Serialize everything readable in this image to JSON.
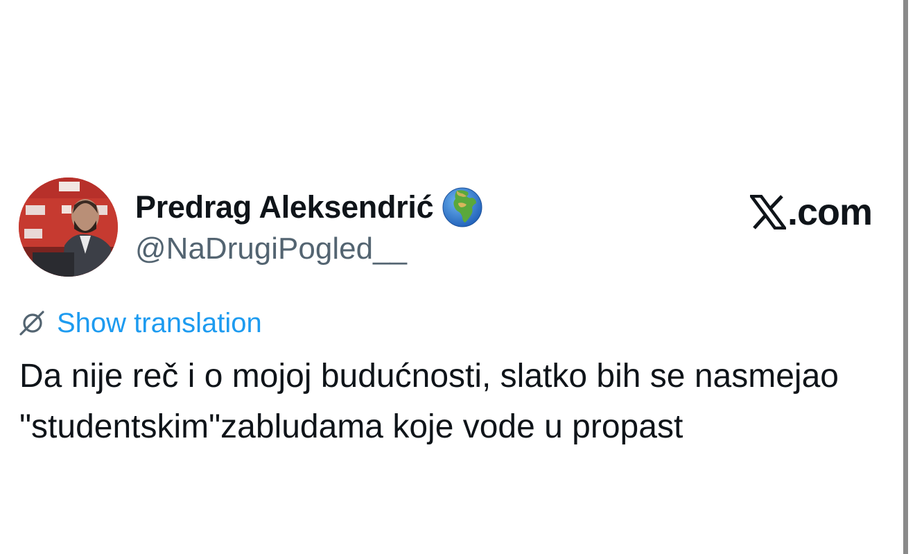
{
  "tweet": {
    "author": {
      "display_name": "Predrag Aleksendrić",
      "handle": "@NaDrugiPogled__",
      "badge_icon": "globe-africa-europe-icon",
      "avatar": "avatar-photo"
    },
    "brand": {
      "icon": "x-logo-icon",
      "text": ".com"
    },
    "translation": {
      "icon": "translate-icon",
      "label": "Show translation"
    },
    "text": "Da nije reč i o mojoj budućnosti, slatko bih se nasmejao \"studentskim\"zabludama koje vode u propast"
  },
  "colors": {
    "link": "#1d9bf0",
    "secondary_text": "#536471",
    "primary_text": "#0f1419",
    "background": "#ffffff",
    "edge_bar": "#8a8a8a"
  }
}
